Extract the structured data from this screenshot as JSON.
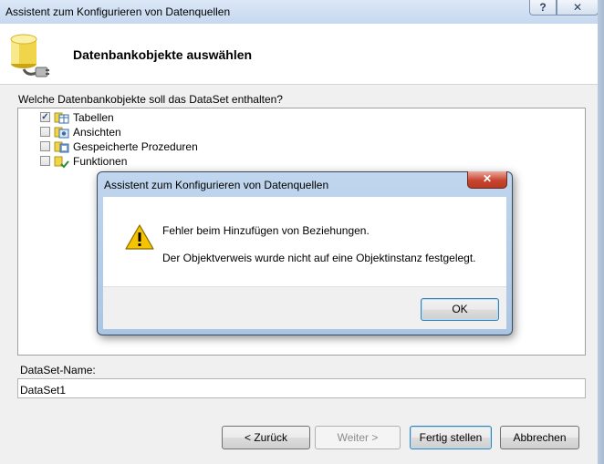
{
  "window": {
    "title": "Assistent zum Konfigurieren von Datenquellen",
    "help_glyph": "?",
    "close_glyph": "✕"
  },
  "header": {
    "title": "Datenbankobjekte auswählen",
    "icon": "database-plug-icon"
  },
  "question": "Welche Datenbankobjekte soll das DataSet enthalten?",
  "tree": {
    "items": [
      {
        "label": "Tabellen",
        "checked": true,
        "icon": "tables-icon"
      },
      {
        "label": "Ansichten",
        "checked": false,
        "icon": "views-icon"
      },
      {
        "label": "Gespeicherte Prozeduren",
        "checked": false,
        "icon": "stored-procedures-icon"
      },
      {
        "label": "Funktionen",
        "checked": false,
        "icon": "functions-icon"
      }
    ]
  },
  "dataset": {
    "label": "DataSet-Name:",
    "value": "DataSet1"
  },
  "buttons": {
    "back": "< Zurück",
    "next": "Weiter >",
    "finish": "Fertig stellen",
    "cancel": "Abbrechen"
  },
  "dialog": {
    "title": "Assistent zum Konfigurieren von Datenquellen",
    "close_glyph": "✕",
    "icon": "warning-icon",
    "message1": "Fehler beim Hinzufügen von Beziehungen.",
    "message2": "Der Objektverweis wurde nicht auf eine Objektinstanz festgelegt.",
    "ok": "OK"
  },
  "colors": {
    "titlebar": "#c6d8ef",
    "dialog_frame": "#aac5e3",
    "close_red": "#c8442f",
    "warning_yellow": "#f5c400"
  }
}
